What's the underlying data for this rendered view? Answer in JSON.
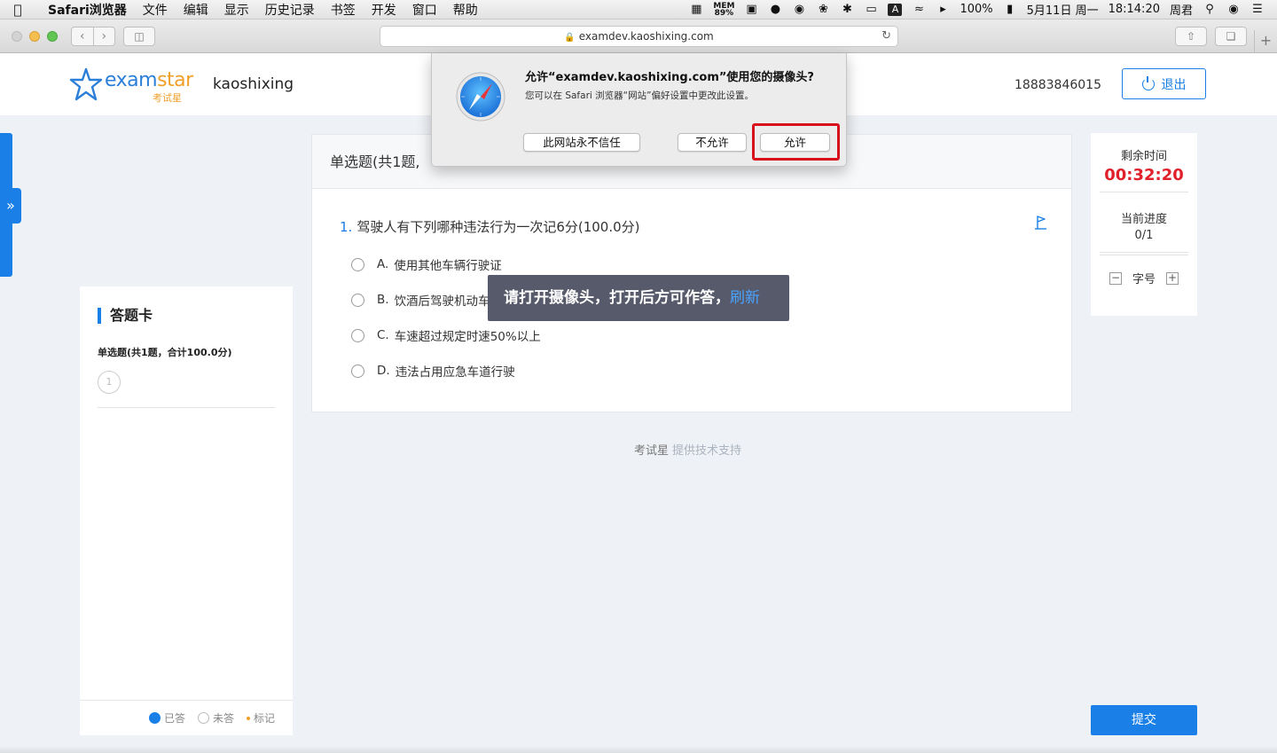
{
  "menubar": {
    "app_name": "Safari浏览器",
    "items": [
      "文件",
      "编辑",
      "显示",
      "历史记录",
      "书签",
      "开发",
      "窗口",
      "帮助"
    ],
    "status": {
      "mem_label": "MEM",
      "mem_value": "89%",
      "battery": "100%",
      "date": "5月11日 周一",
      "time": "18:14:20",
      "user": "周君",
      "input_method": "A"
    }
  },
  "browser": {
    "url": "examdev.kaoshixing.com"
  },
  "header": {
    "logo_text_a": "exam",
    "logo_text_b": "star",
    "logo_sub": "考试星",
    "org_name": "kaoshixing",
    "phone": "18883846015",
    "logout_label": "退出"
  },
  "answer_card": {
    "title": "答题卡",
    "section_label": "单选题(共1题，合计100.0分)",
    "question_numbers": [
      "1"
    ],
    "legend": {
      "answered": "已答",
      "unanswered": "未答",
      "marked": "标记"
    }
  },
  "question_panel": {
    "section_header": "单选题(共1题,",
    "question_number": "1.",
    "question_text": "驾驶人有下列哪种违法行为一次记6分(100.0分)",
    "options": [
      {
        "letter": "A.",
        "text": "使用其他车辆行驶证"
      },
      {
        "letter": "B.",
        "text": "饮酒后驾驶机动车"
      },
      {
        "letter": "C.",
        "text": "车速超过规定时速50%以上"
      },
      {
        "letter": "D.",
        "text": "违法占用应急车道行驶"
      }
    ]
  },
  "toast": {
    "message": "请打开摄像头，打开后方可作答，",
    "link": "刷新"
  },
  "footer": {
    "brand": "考试星",
    "text": "提供技术支持"
  },
  "status_panel": {
    "time_label": "剩余时间",
    "time_value": "00:32:20",
    "progress_label": "当前进度",
    "progress_value": "0/1",
    "font_label": "字号",
    "minus": "−",
    "plus": "+"
  },
  "submit_label": "提交",
  "permission_dialog": {
    "title": "允许“examdev.kaoshixing.com”使用您的摄像头?",
    "subtitle": "您可以在 Safari 浏览器“网站”偏好设置中更改此设置。",
    "never_trust": "此网站永不信任",
    "deny": "不允许",
    "allow": "允许"
  },
  "colors": {
    "accent": "#1a7fe6",
    "timer_red": "#e0212b",
    "highlight_red": "#d8121d",
    "brand_orange": "#f0a02a",
    "toast_bg": "#575a6b"
  }
}
